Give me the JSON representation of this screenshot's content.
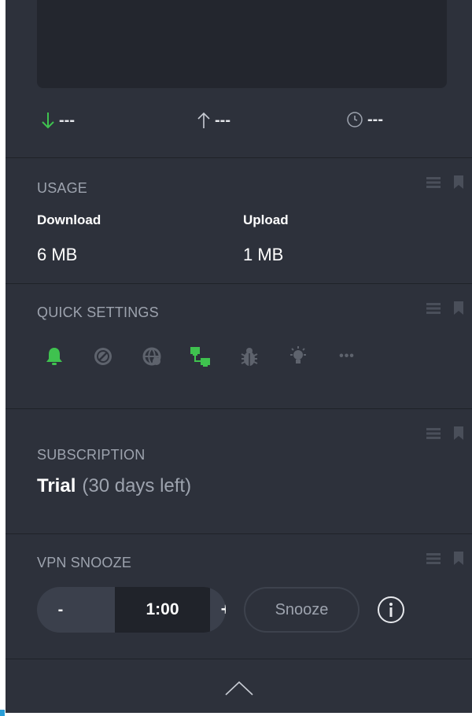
{
  "stats": {
    "download": "---",
    "upload": "---",
    "time": "---"
  },
  "usage": {
    "title": "USAGE",
    "download_label": "Download",
    "download_value": "6 MB",
    "upload_label": "Upload",
    "upload_value": "1 MB"
  },
  "quick_settings": {
    "title": "QUICK SETTINGS",
    "icons": [
      "bell-icon",
      "block-icon",
      "globe-icon",
      "network-icon",
      "bug-icon",
      "lightbulb-icon",
      "more-icon"
    ],
    "more_label": "•••"
  },
  "subscription": {
    "title": "SUBSCRIPTION",
    "plan": "Trial",
    "remaining": "(30 days left)"
  },
  "vpn_snooze": {
    "title": "VPN SNOOZE",
    "minus_label": "-",
    "duration": "1:00",
    "plus_label": "+",
    "snooze_label": "Snooze"
  },
  "colors": {
    "accent_green": "#3fc24f",
    "panel_bg": "#2d313b",
    "muted_text": "#9da3ae"
  }
}
